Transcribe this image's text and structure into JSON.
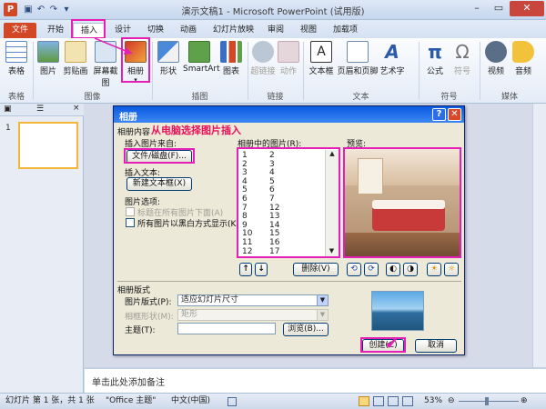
{
  "window": {
    "title": "演示文稿1 - Microsoft PowerPoint (试用版)",
    "app_icon": "P",
    "qat": [
      "save-icon",
      "undo-icon",
      "redo-icon",
      "customize-icon"
    ],
    "controls": {
      "minimize": "–",
      "restore": "▭",
      "close": "✕"
    }
  },
  "tabs": [
    {
      "label": "文件"
    },
    {
      "label": "开始"
    },
    {
      "label": "插入"
    },
    {
      "label": "设计"
    },
    {
      "label": "切换"
    },
    {
      "label": "动画"
    },
    {
      "label": "幻灯片放映"
    },
    {
      "label": "审阅"
    },
    {
      "label": "视图"
    },
    {
      "label": "加载项"
    }
  ],
  "ribbon": {
    "buttons": {
      "table": "表格",
      "picture": "图片",
      "clipart": "剪贴画",
      "screenshot": "屏幕截图",
      "album": "相册",
      "shapes": "形状",
      "smartart": "SmartArt",
      "chart": "图表",
      "hyperlink": "超链接",
      "action": "动作",
      "textbox": "文本框",
      "header_footer": "页眉和页脚",
      "wordart": "艺术字",
      "formula": "公式",
      "symbol": "符号",
      "video": "视频",
      "audio": "音频"
    },
    "groups": {
      "tables": "表格",
      "images": "图像",
      "illustrations": "插图",
      "links": "链接",
      "text": "文本",
      "symbols": "符号",
      "media": "媒体"
    }
  },
  "left_panel": {
    "tab_slides": "▣",
    "tab_outline": "☰",
    "slide_number": "1",
    "close": "×"
  },
  "notes": {
    "placeholder": "单击此处添加备注"
  },
  "status": {
    "slide_info": "幻灯片 第 1 张，共 1 张",
    "theme": "\"Office 主题\"",
    "language": "中文(中国)",
    "zoom": "53%"
  },
  "dialog": {
    "title": "相册",
    "annotation": "从电脑选择图片插入",
    "album_content": "相册内容",
    "insert_from": "插入图片来自:",
    "file_disk_btn": "文件/磁盘(F)...",
    "insert_text": "插入文本:",
    "new_textbox_btn": "新建文本框(X)",
    "picture_options": "图片选项:",
    "caption_below": "标题在所有图片下面(A)",
    "all_bw": "所有图片以黑白方式显示(K)",
    "pictures_in_album": "相册中的图片(R):",
    "preview": "预览:",
    "list": [
      [
        "1",
        "2"
      ],
      [
        "2",
        "3"
      ],
      [
        "3",
        "4"
      ],
      [
        "4",
        "5"
      ],
      [
        "5",
        "6"
      ],
      [
        "6",
        "7"
      ],
      [
        "7",
        "12"
      ],
      [
        "8",
        "13"
      ],
      [
        "9",
        "14"
      ],
      [
        "10",
        "15"
      ],
      [
        "11",
        "16"
      ],
      [
        "12",
        "17"
      ]
    ],
    "remove_btn": "删除(V)",
    "album_layout": "相册版式",
    "pic_layout_label": "图片版式(P):",
    "pic_layout_value": "适应幻灯片尺寸",
    "frame_label": "相框形状(M):",
    "frame_value": "矩形",
    "theme_label": "主题(T):",
    "theme_value": "",
    "browse_btn": "浏览(B)...",
    "create_btn": "创建(C)",
    "cancel_btn": "取消"
  },
  "colors": {
    "accent_pink": "#e51fb6",
    "file_tab": "#d24726",
    "dialog_title": "#0b5ae0",
    "annotation_red": "#e8115a"
  }
}
